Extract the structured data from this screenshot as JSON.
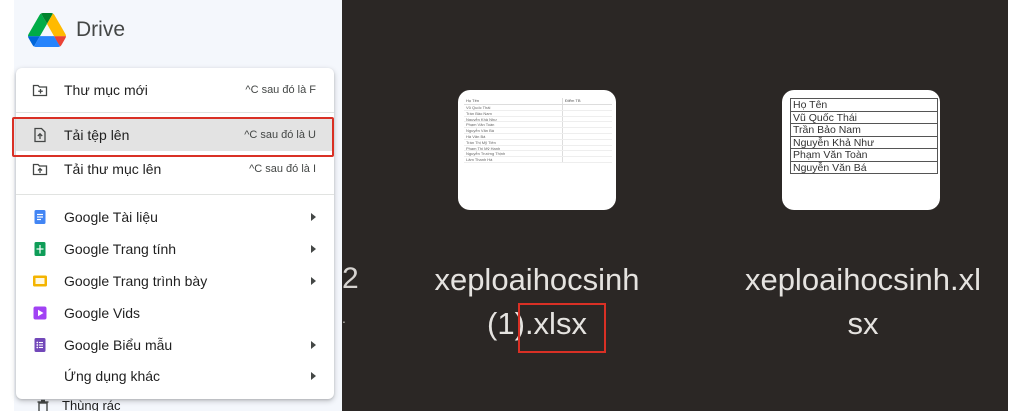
{
  "app": {
    "title": "Drive",
    "bottom_item": "Thùng rác"
  },
  "menu": {
    "items": [
      {
        "id": "new-folder",
        "label": "Thư mục mới",
        "shortcut": "^C sau đó là F",
        "icon": "folder-plus-icon"
      },
      {
        "id": "upload-file",
        "label": "Tải tệp lên",
        "shortcut": "^C sau đó là U",
        "icon": "file-upload-icon"
      },
      {
        "id": "upload-folder",
        "label": "Tải thư mục lên",
        "shortcut": "^C sau đó là I",
        "icon": "folder-upload-icon"
      },
      {
        "id": "google-docs",
        "label": "Google Tài liệu",
        "icon": "docs-icon",
        "color": "#4285f4",
        "submenu": true
      },
      {
        "id": "google-sheets",
        "label": "Google Trang tính",
        "icon": "sheets-icon",
        "color": "#0f9d58",
        "submenu": true
      },
      {
        "id": "google-slides",
        "label": "Google Trang trình bày",
        "icon": "slides-icon",
        "color": "#f4b400",
        "submenu": true
      },
      {
        "id": "google-vids",
        "label": "Google Vids",
        "icon": "vids-icon",
        "color": "#a142f4",
        "submenu": false
      },
      {
        "id": "google-forms",
        "label": "Google Biểu mẫu",
        "icon": "forms-icon",
        "color": "#7248b9",
        "submenu": true
      },
      {
        "id": "more-apps",
        "label": "Ứng dụng khác",
        "submenu": true
      }
    ]
  },
  "files": {
    "partial_text": "2",
    "partial_sub": ".",
    "file1": {
      "name_line1": "xeploaihocsinh",
      "name_line2_prefix": "(1)",
      "name_line2_ext": ".xlsx",
      "sheet_header": [
        "Họ Tên",
        "Điểm TB"
      ],
      "sheet_rows": [
        "Vũ Quốc Thái",
        "Trần Bảo Nam",
        "Nguyễn Khả Như",
        "Phạm Văn Toàn",
        "Nguyễn Văn Bá",
        "Hà Văn Bá",
        "Trần Thị Mỹ Tiên",
        "Phạm Thị Mỹ Hạnh",
        "Nguyễn Trường Thịnh",
        "Lâm Thanh Hà"
      ]
    },
    "file2": {
      "name_line1": "xeploaihocsinh.xl",
      "name_line2": "sx",
      "sheet_rows": [
        "Họ Tên",
        "Vũ Quốc Thái",
        "Trần Bảo Nam",
        "Nguyễn Khả Như",
        "Phạm Văn Toàn",
        "Nguyễn Văn Bá"
      ]
    }
  },
  "colors": {
    "highlight": "#d93025",
    "dark_bg": "#2b2725",
    "menu_active": "#e3e3e3"
  }
}
